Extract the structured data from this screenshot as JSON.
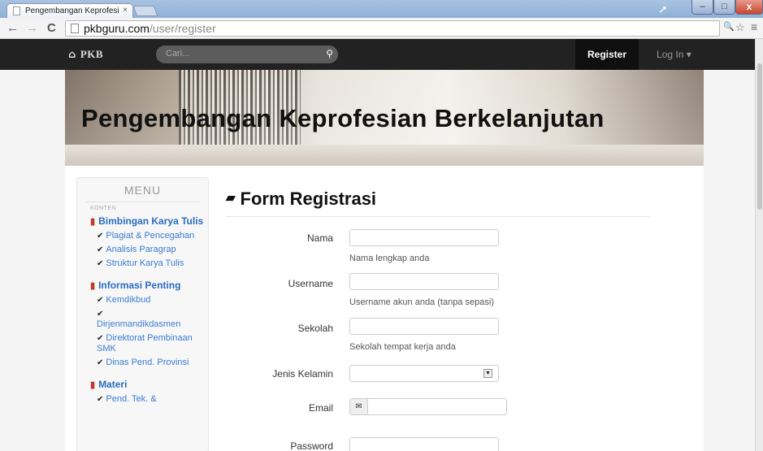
{
  "browser": {
    "tab_title": "Pengembangan Keprofesi",
    "tab_close": "×",
    "url_host": "pkbguru.com",
    "url_path": "/user/register",
    "back": "←",
    "forward": "→",
    "reload": "C",
    "zoom_icon": "🔍",
    "star_icon": "☆",
    "menu_icon": "≡",
    "win_min": "–",
    "win_max": "□",
    "win_close": "x"
  },
  "navbar": {
    "home_icon": "⌂",
    "brand": "PKB",
    "search_placeholder": "Cari...",
    "search_icon": "⚲",
    "register": "Register",
    "login": "Log In ▾"
  },
  "banner": {
    "title": "Pengembangan Keprofesian Berkelanjutan"
  },
  "sidebar": {
    "title": "MENU",
    "kicker": "KONTEN",
    "mark": "▮",
    "check": "✔",
    "sections": [
      {
        "label": "Bimbingan Karya Tulis",
        "items": [
          "Plagiat & Pencegahan",
          "Analisis Paragrap",
          "Struktur Karya Tulis"
        ]
      },
      {
        "label": "Informasi Penting",
        "items": [
          "Kemdikbud",
          "Dirjenmandikdasmen",
          "Direktorat Pembinaan SMK",
          "Dinas Pend. Provinsi"
        ]
      },
      {
        "label": "Materi",
        "items": [
          "Pend. Tek. &"
        ]
      }
    ]
  },
  "form": {
    "heading_icon": "▰",
    "heading": "Form Registrasi",
    "nama_label": "Nama",
    "nama_help": "Nama lengkap anda",
    "username_label": "Username",
    "username_help": "Username akun anda (tanpa sepasi)",
    "sekolah_label": "Sekolah",
    "sekolah_help": "Sekolah tempat kerja anda",
    "jk_label": "Jenis Kelamin",
    "jk_arrow": "▼",
    "email_label": "Email",
    "email_icon": "✉",
    "password_label": "Password"
  }
}
